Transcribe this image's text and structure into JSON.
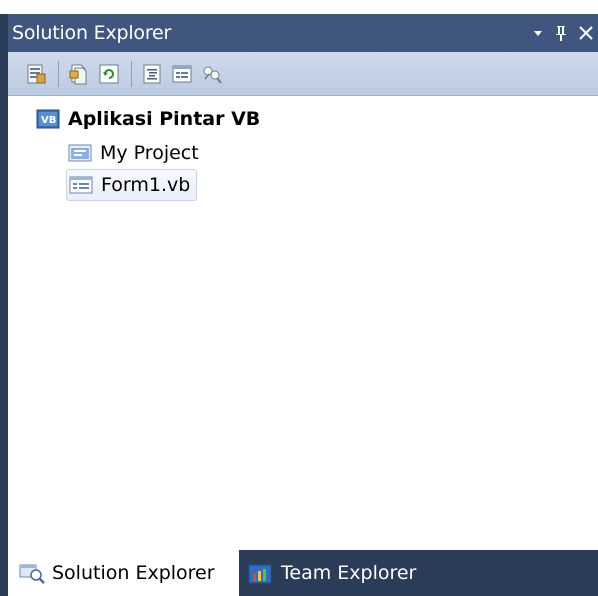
{
  "window": {
    "title": "Solution Explorer",
    "controls": [
      "dropdown-icon",
      "pin-icon",
      "close-icon"
    ]
  },
  "toolbar": {
    "icons": [
      "properties-icon",
      "show-all-files-icon",
      "refresh-icon",
      "view-code-icon",
      "view-designer-icon",
      "view-class-diagram-icon"
    ]
  },
  "tree": {
    "root": {
      "label": "Aplikasi Pintar VB",
      "icon": "vb-project-icon"
    },
    "items": [
      {
        "label": "My Project",
        "icon": "my-project-icon"
      },
      {
        "label": "Form1.vb",
        "icon": "form-icon",
        "selected": true
      }
    ]
  },
  "tabs": [
    {
      "label": "Solution Explorer",
      "icon": "solution-explorer-icon",
      "active": true
    },
    {
      "label": "Team Explorer",
      "icon": "team-explorer-icon",
      "active": false
    }
  ],
  "colors": {
    "title_bar": "#40567f",
    "frame": "#2b3c59",
    "toolbar": "#c6d3e7",
    "selection_border": "#c9d3e6"
  }
}
